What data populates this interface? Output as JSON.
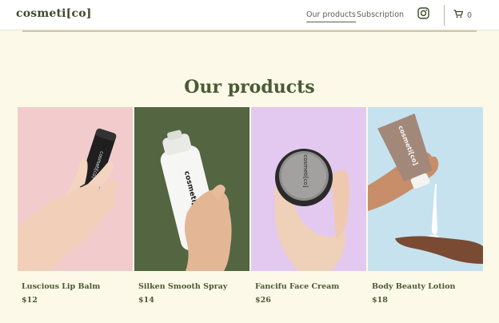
{
  "header": {
    "brand": "cosmeti[co]",
    "nav": [
      {
        "label": "Our products",
        "active": true
      },
      {
        "label": "Subscription",
        "active": false
      }
    ],
    "cart_count": "0",
    "icons": [
      "instagram-icon",
      "cart-icon"
    ]
  },
  "main": {
    "title": "Our products",
    "products": [
      {
        "name": "Luscious Lip Balm",
        "price": "$12",
        "bg": "#f2cccc"
      },
      {
        "name": "Silken Smooth Spray",
        "price": "$14",
        "bg": "#546541"
      },
      {
        "name": "Fancifu Face Cream",
        "price": "$26",
        "bg": "#e3c9f0"
      },
      {
        "name": "Body Beauty Lotion",
        "price": "$18",
        "bg": "#c6e2ee"
      }
    ]
  },
  "colors": {
    "page_bg": "#fcf9e8",
    "text_green": "#4a5a36"
  }
}
